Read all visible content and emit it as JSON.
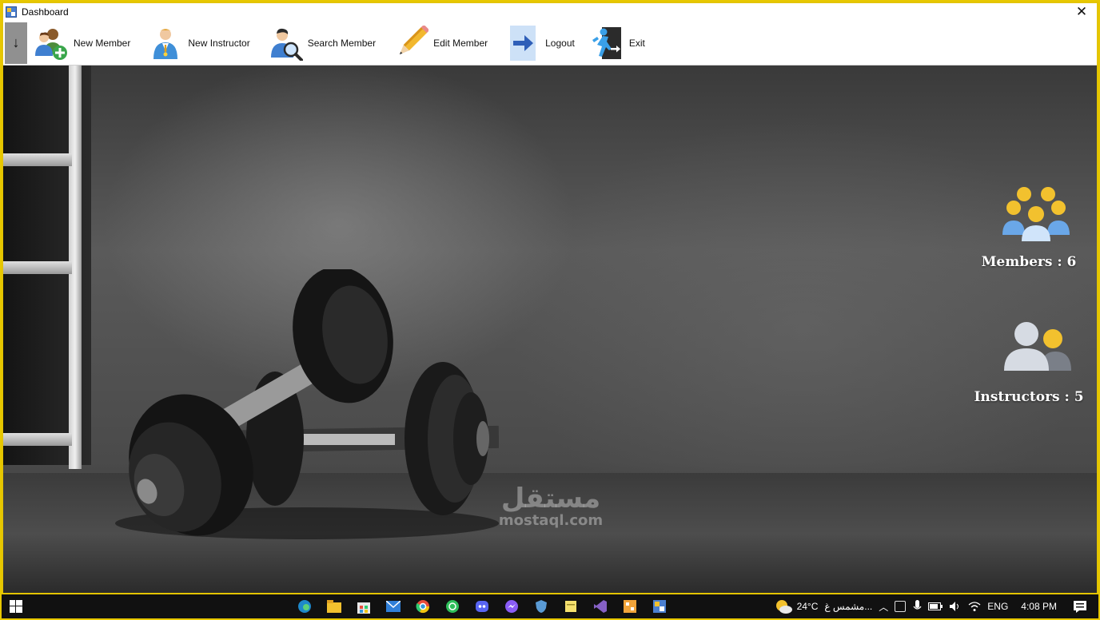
{
  "window": {
    "title": "Dashboard",
    "close_glyph": "✕"
  },
  "toolbar": {
    "toggle_glyph": "↓",
    "items": [
      {
        "label": "New Member",
        "icon": "add-user-icon"
      },
      {
        "label": "New Instructor",
        "icon": "instructor-icon"
      },
      {
        "label": "Search Member",
        "icon": "search-user-icon"
      },
      {
        "label": "Edit Member",
        "icon": "pencil-icon"
      },
      {
        "label": "Logout",
        "icon": "logout-arrow-icon"
      },
      {
        "label": "Exit",
        "icon": "exit-door-icon"
      }
    ]
  },
  "stats": {
    "members_label": "Members : 6",
    "instructors_label": "Instructors : 5"
  },
  "watermark": {
    "arabic": "مستقل",
    "latin": "mostaql.com"
  },
  "taskbar": {
    "weather_temp": "24°C",
    "weather_text": "مشمس غ...",
    "language": "ENG",
    "time": "4:08 PM"
  },
  "colors": {
    "accent_gold": "#f2c12e",
    "user_blue": "#6aa7e8",
    "window_border": "#e3c400"
  }
}
